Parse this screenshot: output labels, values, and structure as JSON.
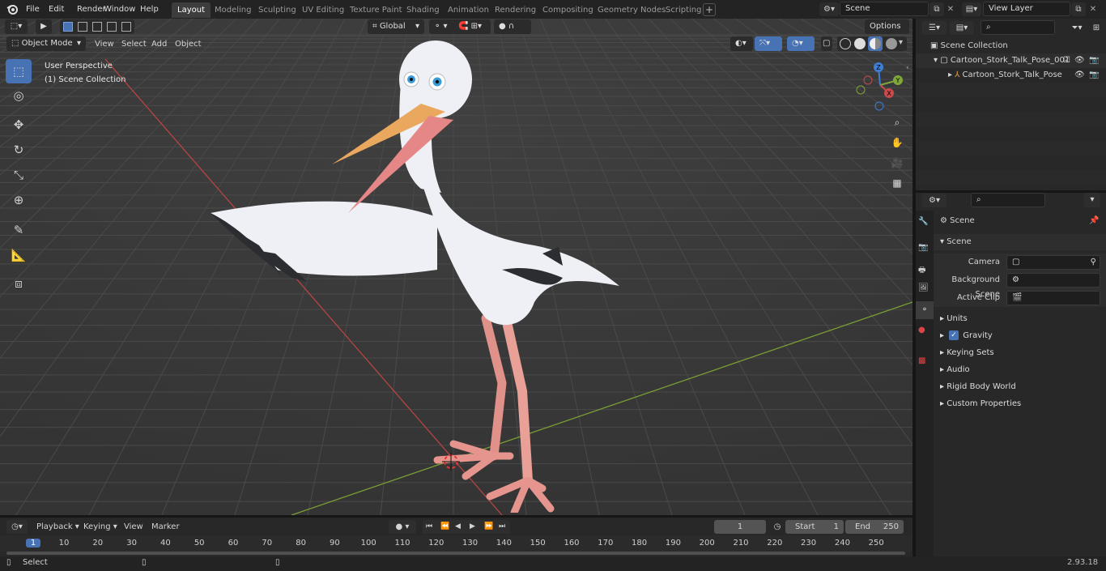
{
  "topbar": {
    "menus": [
      "File",
      "Edit",
      "Render",
      "Window",
      "Help"
    ],
    "workspaces": [
      "Layout",
      "Modeling",
      "Sculpting",
      "UV Editing",
      "Texture Paint",
      "Shading",
      "Animation",
      "Rendering",
      "Compositing",
      "Geometry Nodes",
      "Scripting"
    ],
    "active_workspace": "Layout",
    "scene_name": "Scene",
    "view_layer": "View Layer"
  },
  "viewport_header": {
    "mode": "Object Mode",
    "menus": [
      "View",
      "Select",
      "Add",
      "Object"
    ],
    "transform_orientation": "Global",
    "options_label": "Options"
  },
  "viewport": {
    "perspective_label": "User Perspective",
    "collection_label": "(1) Scene Collection",
    "gizmo_axes": {
      "x": "X",
      "y": "Y",
      "z": "Z"
    }
  },
  "outliner": {
    "root": "Scene Collection",
    "collection": "Cartoon_Stork_Talk_Pose_001",
    "object": "Cartoon_Stork_Talk_Pose"
  },
  "properties": {
    "context_title": "Scene",
    "panel_title": "Scene",
    "fields": [
      {
        "label": "Camera"
      },
      {
        "label": "Background Scene"
      },
      {
        "label": "Active Clip"
      }
    ],
    "subpanels": [
      "Units",
      "Gravity",
      "Keying Sets",
      "Audio",
      "Rigid Body World",
      "Custom Properties"
    ],
    "gravity_checked": true
  },
  "timeline": {
    "menus": [
      "Playback",
      "Keying",
      "View",
      "Marker"
    ],
    "current_frame": "1",
    "start_label": "Start",
    "start_value": "1",
    "end_label": "End",
    "end_value": "250",
    "ruler": [
      "1",
      "10",
      "20",
      "30",
      "40",
      "50",
      "60",
      "70",
      "80",
      "90",
      "100",
      "110",
      "120",
      "130",
      "140",
      "150",
      "160",
      "170",
      "180",
      "190",
      "200",
      "210",
      "220",
      "230",
      "240",
      "250"
    ]
  },
  "statusbar": {
    "hint": "Select",
    "version": "2.93.18"
  },
  "colors": {
    "accent": "#4772b3",
    "x_axis": "#c84a4a",
    "y_axis": "#7fa73a",
    "z_axis": "#3f7ed6"
  }
}
